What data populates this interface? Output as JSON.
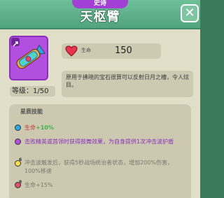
{
  "header": {
    "rarity": "史诗",
    "title": "天枢臂"
  },
  "item": {
    "level_label": "等级：1/50",
    "stat_label": "生命",
    "stat_value": "150",
    "description": "原用于拂晓的宝石很算可以反射日月之槽，令人炫目。"
  },
  "skills": {
    "title": "星质技能",
    "entries": [
      {
        "text_a": "生命",
        "text_b": "+10%",
        "color": "#2aa8e8",
        "lock": ""
      },
      {
        "text_a": "击败精英或首领时获得鼓舞效果，为自身提供1次冲击波护盾",
        "text_b": "",
        "color": "#b24ee0",
        "lock": ""
      },
      {
        "text_a": "冲击波触发后，获得5秒战场统治者状态，增加200%伤害，100%移速",
        "text_b": "",
        "color": "#ffe24a",
        "lock": "6"
      },
      {
        "text_a": "生命+15%",
        "text_b": "",
        "color": "#e05070",
        "lock": "8"
      }
    ]
  },
  "colors": {
    "header_green": "#4fa37d",
    "epic_purple": "#a43fd6",
    "heart_red": "#e8344e"
  }
}
